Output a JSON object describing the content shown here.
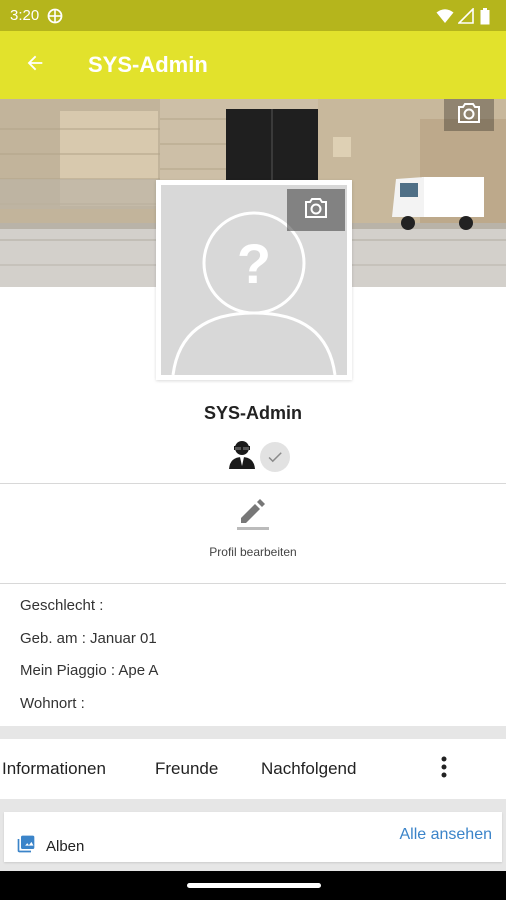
{
  "status_bar": {
    "time": "3:20",
    "icons": [
      "vpn-globe-icon",
      "wifi-icon",
      "signal-icon",
      "battery-icon"
    ]
  },
  "app_bar": {
    "title": "SYS-Admin",
    "back_icon": "arrow-back-icon",
    "color": "#e2e22c"
  },
  "profile": {
    "name": "SYS-Admin",
    "badges": [
      "admin-agent-icon",
      "check-icon"
    ],
    "edit_label": "Profil bearbeiten"
  },
  "info": {
    "rows": [
      "Geschlecht :",
      "Geb. am : Januar 01",
      "Mein Piaggio : Ape A",
      "Wohnort :"
    ]
  },
  "tabs": {
    "items": [
      "Informationen",
      "Freunde",
      "Nachfolgend"
    ],
    "more_icon": "more-vert-icon"
  },
  "albums": {
    "label": "Alben",
    "link": "Alle ansehen",
    "link_color": "#3b84c9"
  }
}
